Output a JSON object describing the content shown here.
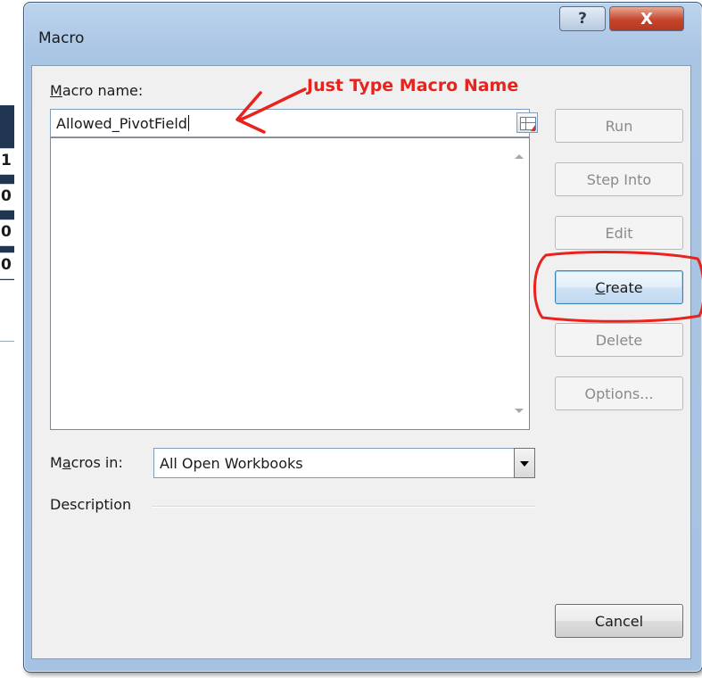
{
  "window": {
    "title": "Macro",
    "help_glyph": "?",
    "close_glyph": "X"
  },
  "background": {
    "row_glyphs": [
      "1",
      "0",
      "0",
      "0"
    ]
  },
  "form": {
    "macro_name_label_accel": "M",
    "macro_name_label_rest": "acro name:",
    "macro_name_value": "Allowed_PivotField",
    "macros_in_label_first": "M",
    "macros_in_label_accel": "a",
    "macros_in_label_rest": "cros in:",
    "macros_in_value": "All Open Workbooks",
    "description_label": "Description"
  },
  "buttons": {
    "run": "Run",
    "step_into": "Step Into",
    "edit": "Edit",
    "create_accel": "C",
    "create_rest": "reate",
    "delete": "Delete",
    "options": "Options...",
    "cancel": "Cancel"
  },
  "annotation": {
    "text": "Just Type Macro Name",
    "color": "#e8231e"
  }
}
